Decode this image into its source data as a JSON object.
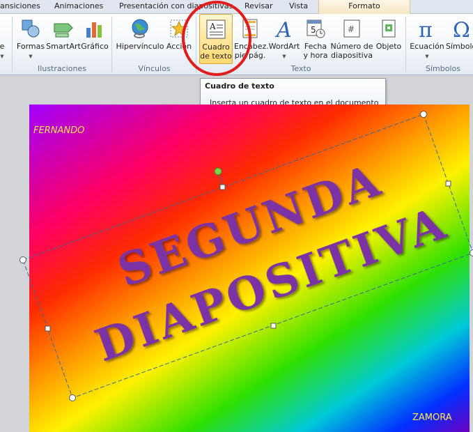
{
  "tabs": [
    {
      "label": "ansiciones"
    },
    {
      "label": "Animaciones"
    },
    {
      "label": "Presentación con diapositivas"
    },
    {
      "label": "Revisar"
    },
    {
      "label": "Vista"
    },
    {
      "label": "Formato"
    }
  ],
  "ribbon": {
    "partial_label": "e",
    "groups": {
      "illustrations": "Ilustraciones",
      "links": "Vínculos",
      "text": "Texto",
      "symbols": "Símbolos"
    },
    "buttons": {
      "shapes": "Formas",
      "smartart": "SmartArt",
      "chart": "Gráfico",
      "hyperlink": "Hipervínculo",
      "action": "Acción",
      "textbox_l1": "Cuadro",
      "textbox_l2": "de texto",
      "header_l1": "Encabez.",
      "header_l2": "pie pág.",
      "wordart": "WordArt",
      "date_l1": "Fecha",
      "date_l2": "y hora",
      "slide_number_l1": "Número de",
      "slide_number_l2": "diapositiva",
      "object": "Objeto",
      "equation": "Ecuación",
      "symbol": "Símbolo"
    }
  },
  "tooltip": {
    "title": "Cuadro de texto",
    "description": "Inserta un cuadro de texto en el documento o agrega texto a la forma seleccionada."
  },
  "slide": {
    "author": "FERNANDO",
    "city": "ZAMORA",
    "wordart_line1": "SEGUNDA",
    "wordart_line2": "DIAPOSITIVA",
    "wordart_color": "#7a32a4"
  },
  "colors": {
    "highlight_circle": "#e21b1b",
    "tooltip_border": "#8e9aab"
  }
}
